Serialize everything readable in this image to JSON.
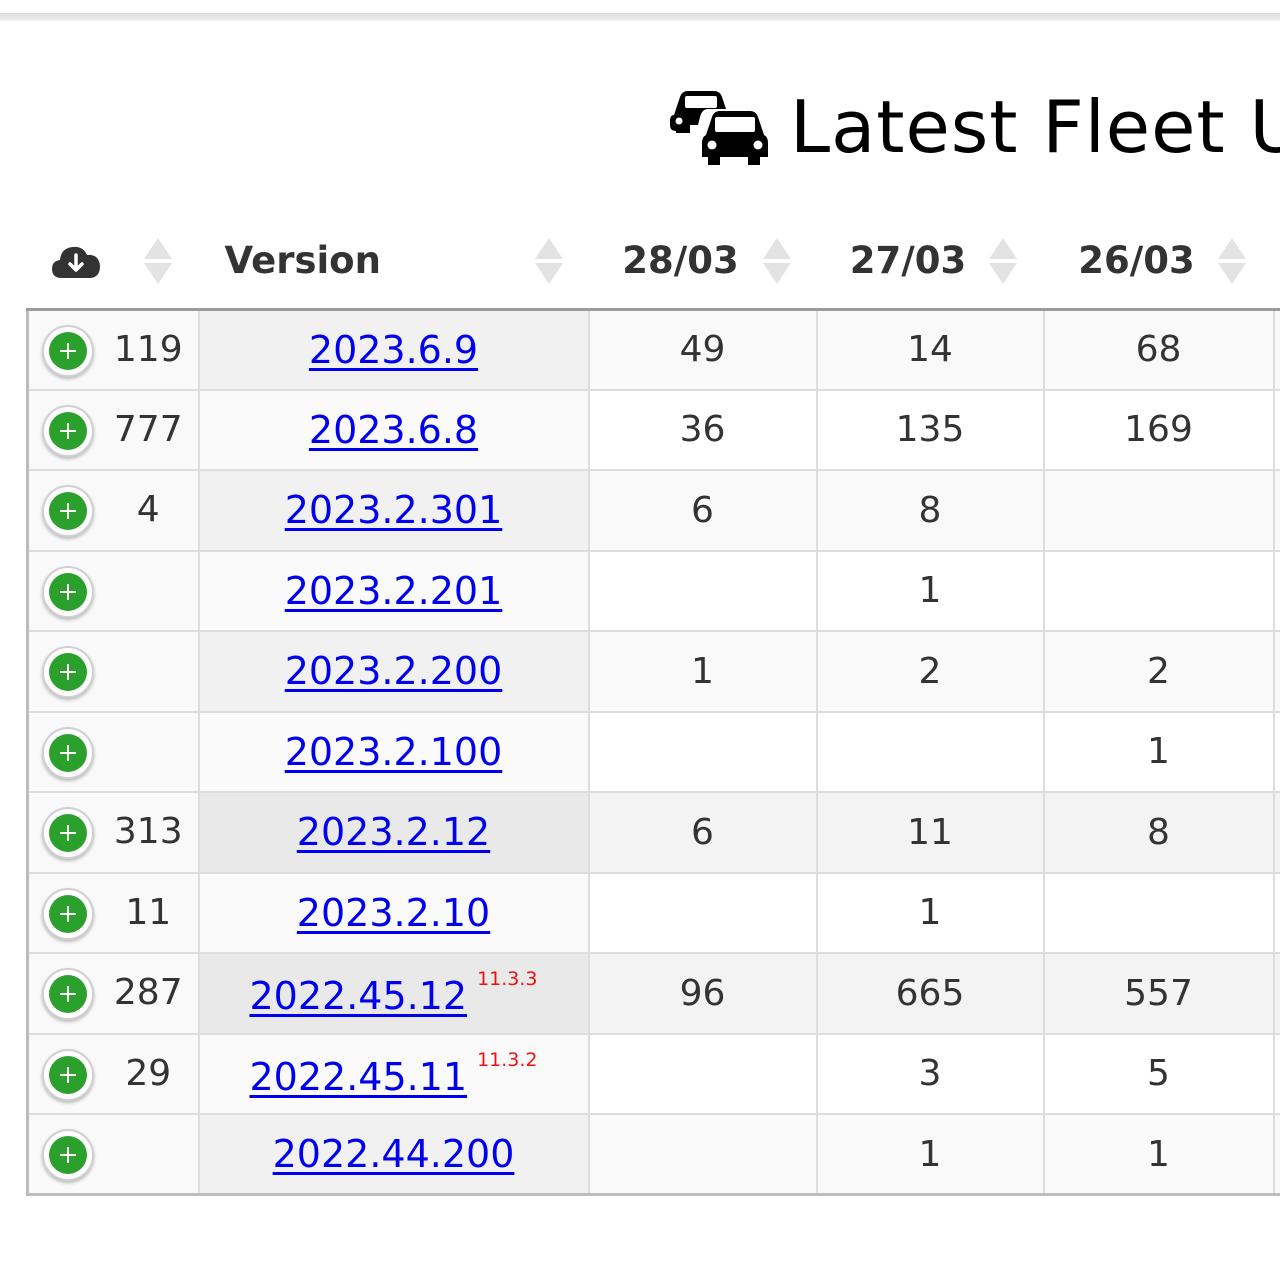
{
  "page_title": "Latest Fleet U",
  "icons": {
    "title": "two-cars-icon",
    "download_column": "cloud-download-icon",
    "row_action": "green-plus-button-icon"
  },
  "colors": {
    "link": "#0000ee",
    "superscript": "#ee1111",
    "add_button": "#2ca02c"
  },
  "table": {
    "headers": {
      "download": "",
      "version": "Version",
      "date1": "28/03",
      "date2": "27/03",
      "date3": "26/03"
    },
    "rows": [
      {
        "downloads": "119",
        "version": "2023.6.9",
        "sup": "",
        "d1": "49",
        "d2": "14",
        "d3": "68"
      },
      {
        "downloads": "777",
        "version": "2023.6.8",
        "sup": "",
        "d1": "36",
        "d2": "135",
        "d3": "169"
      },
      {
        "downloads": "4",
        "version": "2023.2.301",
        "sup": "",
        "d1": "6",
        "d2": "8",
        "d3": ""
      },
      {
        "downloads": "",
        "version": "2023.2.201",
        "sup": "",
        "d1": "",
        "d2": "1",
        "d3": ""
      },
      {
        "downloads": "",
        "version": "2023.2.200",
        "sup": "",
        "d1": "1",
        "d2": "2",
        "d3": "2"
      },
      {
        "downloads": "",
        "version": "2023.2.100",
        "sup": "",
        "d1": "",
        "d2": "",
        "d3": "1"
      },
      {
        "downloads": "313",
        "version": "2023.2.12",
        "sup": "",
        "d1": "6",
        "d2": "11",
        "d3": "8"
      },
      {
        "downloads": "11",
        "version": "2023.2.10",
        "sup": "",
        "d1": "",
        "d2": "1",
        "d3": ""
      },
      {
        "downloads": "287",
        "version": "2022.45.12",
        "sup": "11.3.3",
        "d1": "96",
        "d2": "665",
        "d3": "557"
      },
      {
        "downloads": "29",
        "version": "2022.45.11",
        "sup": "11.3.2",
        "d1": "",
        "d2": "3",
        "d3": "5"
      },
      {
        "downloads": "",
        "version": "2022.44.200",
        "sup": "",
        "d1": "",
        "d2": "1",
        "d3": "1"
      }
    ]
  }
}
